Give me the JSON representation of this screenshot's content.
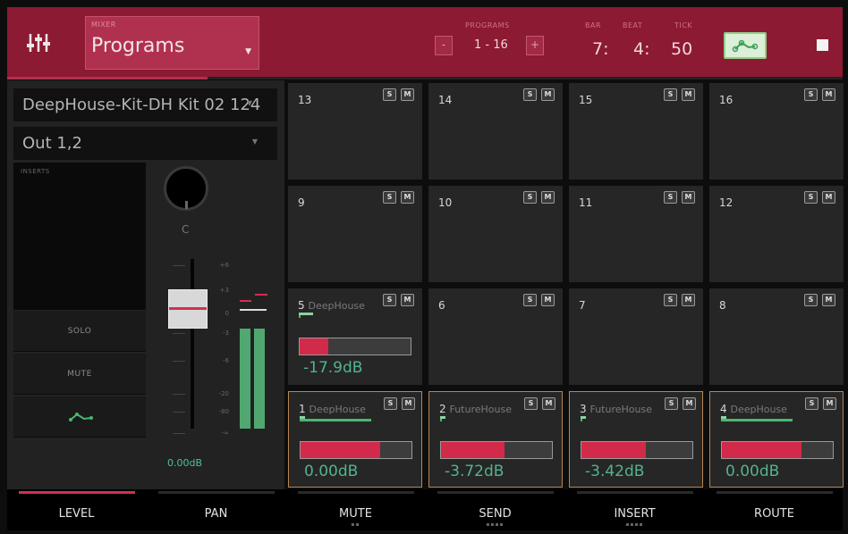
{
  "header": {
    "mixer_label": "MIXER",
    "mode_value": "Programs",
    "programs_label": "PROGRAMS",
    "programs_range": "1 - 16",
    "prev_symbol": "-",
    "next_symbol": "+",
    "bar_label": "BAR",
    "beat_label": "BEAT",
    "tick_label": "TICK",
    "bar_value": "7:",
    "beat_value": "4:",
    "tick_value": "50",
    "progress_fraction": 0.24
  },
  "left_panel": {
    "program_name": "DeepHouse-Kit-DH Kit 02 124",
    "output": "Out 1,2",
    "inserts_label": "INSERTS",
    "solo_label": "SOLO",
    "mute_label": "MUTE",
    "pan_value": "C",
    "fader_value": "0.00dB",
    "fader_scale": [
      "+6",
      "+3",
      "0",
      "-3",
      "-6",
      "-20",
      "-80",
      "-∞"
    ]
  },
  "pads": [
    {
      "number": "13",
      "program": "",
      "level_db": "",
      "level_fraction": 0
    },
    {
      "number": "14",
      "program": "",
      "level_db": "",
      "level_fraction": 0
    },
    {
      "number": "15",
      "program": "",
      "level_db": "",
      "level_fraction": 0
    },
    {
      "number": "16",
      "program": "",
      "level_db": "",
      "level_fraction": 0
    },
    {
      "number": "9",
      "program": "",
      "level_db": "",
      "level_fraction": 0
    },
    {
      "number": "10",
      "program": "",
      "level_db": "",
      "level_fraction": 0
    },
    {
      "number": "11",
      "program": "",
      "level_db": "",
      "level_fraction": 0
    },
    {
      "number": "12",
      "program": "",
      "level_db": "",
      "level_fraction": 0
    },
    {
      "number": "5",
      "program": "DeepHouse",
      "level_db": "-17.9dB",
      "level_fraction": 0.26
    },
    {
      "number": "6",
      "program": "",
      "level_db": "",
      "level_fraction": 0
    },
    {
      "number": "7",
      "program": "",
      "level_db": "",
      "level_fraction": 0
    },
    {
      "number": "8",
      "program": "",
      "level_db": "",
      "level_fraction": 0
    },
    {
      "number": "1",
      "program": "DeepHouse",
      "level_db": "0.00dB",
      "level_fraction": 0.72
    },
    {
      "number": "2",
      "program": "FutureHouse",
      "level_db": "-3.72dB",
      "level_fraction": 0.57
    },
    {
      "number": "3",
      "program": "FutureHouse",
      "level_db": "-3.42dB",
      "level_fraction": 0.58
    },
    {
      "number": "4",
      "program": "DeepHouse",
      "level_db": "0.00dB",
      "level_fraction": 0.72
    }
  ],
  "pad_buttons": {
    "solo": "S",
    "mute": "M"
  },
  "tabs": [
    {
      "label": "LEVEL",
      "active": true,
      "dots": ""
    },
    {
      "label": "PAN",
      "active": false,
      "dots": ""
    },
    {
      "label": "MUTE",
      "active": false,
      "dots": "▪▪"
    },
    {
      "label": "SEND",
      "active": false,
      "dots": "▪▪▪▪"
    },
    {
      "label": "INSERT",
      "active": false,
      "dots": "▪▪▪▪"
    },
    {
      "label": "ROUTE",
      "active": false,
      "dots": ""
    }
  ],
  "colors": {
    "header_bg": "#8c1a32",
    "accent_red": "#d22a4a",
    "level_green": "#52b48c",
    "pad_bg": "#262626",
    "selected_outline": "#b88550"
  }
}
